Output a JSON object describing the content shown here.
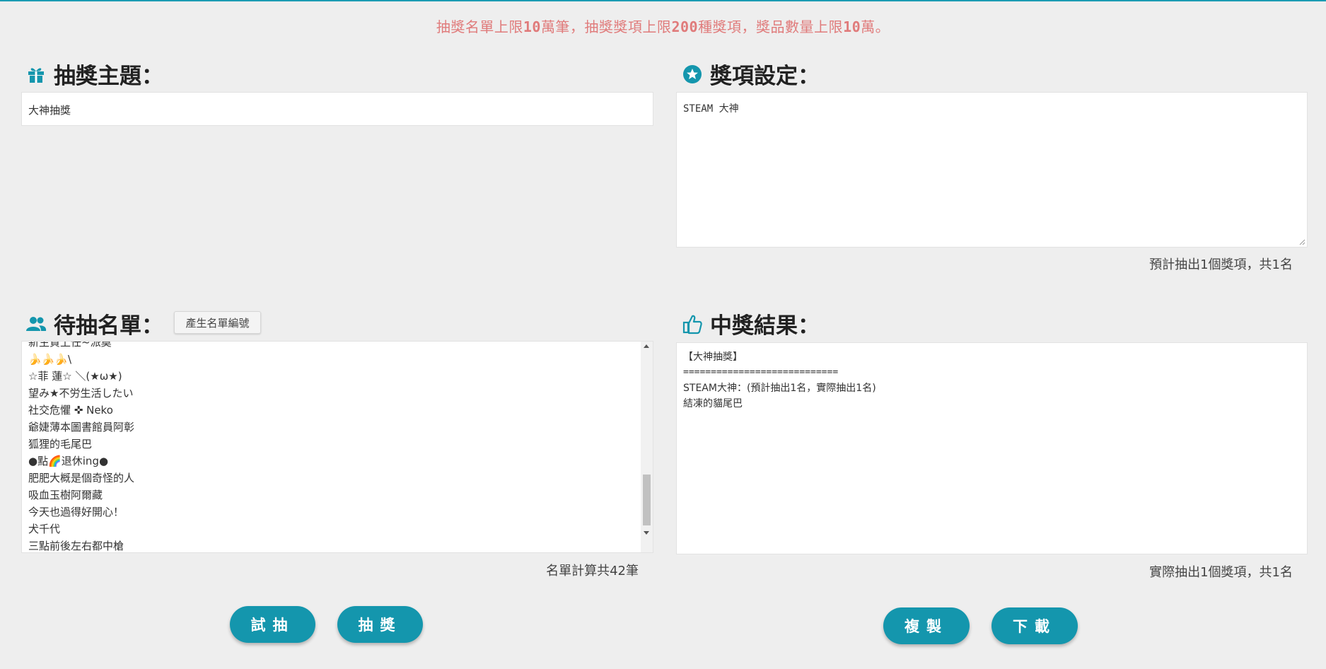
{
  "notice": {
    "part1": "抽獎名單上限",
    "num1": "10",
    "part2": "萬筆，抽獎獎項上限",
    "num2": "200",
    "part3": "種獎項，獎品數量上限",
    "num3": "10",
    "part4": "萬。"
  },
  "theme": {
    "title": "抽獎主題：",
    "value": "大神抽獎"
  },
  "prizes": {
    "title": "獎項設定：",
    "value": "STEAM 大神",
    "summary": "預計抽出1個獎項，共1名"
  },
  "candidates": {
    "title": "待抽名單：",
    "generate_button": "產生名單編號",
    "items": [
      "新生賀上任~派奠",
      "🍌🍌🍌\\",
      "☆菲 蓮☆ ＼(★ω★)",
      "望み★不労生活したい",
      "社交危懼 ✜ Neko",
      "爺婕薄本圖書館員阿彰",
      "狐狸的毛尾巴",
      "●點🌈退休ing●",
      "肥肥大概是個奇怪的人",
      "吸血玉樹阿爾藏",
      "今天也過得好開心！",
      "犬千代",
      "三點前後左右都中槍"
    ],
    "count": "名單計算共42筆"
  },
  "results": {
    "title": "中獎結果：",
    "lines": [
      "【大神抽獎】",
      "============================",
      "STEAM大神：(預計抽出1名，實際抽出1名)",
      "結凍的貓尾巴"
    ],
    "summary": "實際抽出1個獎項，共1名"
  },
  "buttons": {
    "trial": "試抽",
    "draw": "抽獎",
    "copy": "複製",
    "download": "下載"
  },
  "colors": {
    "accent": "#1496ad",
    "notice": "#e07b7b",
    "background": "#eeeeee"
  },
  "icons": {
    "theme": "gift-icon",
    "prizes": "star-circle-icon",
    "candidates": "people-icon",
    "results": "thumbs-up-icon"
  }
}
